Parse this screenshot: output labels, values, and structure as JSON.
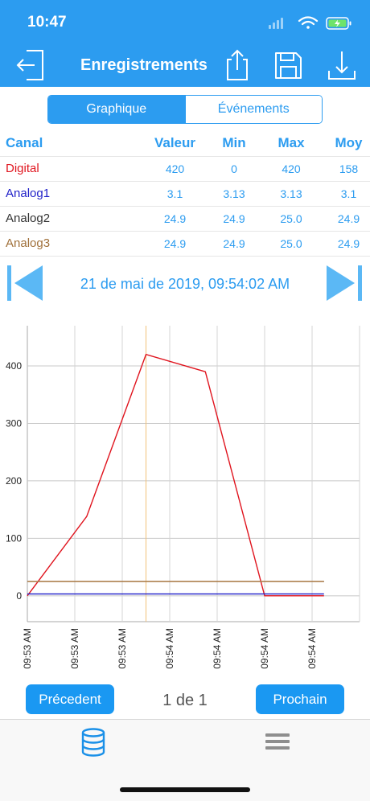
{
  "status": {
    "time": "10:47"
  },
  "header": {
    "title": "Enregistrements"
  },
  "segments": {
    "graph": "Graphique",
    "events": "Événements"
  },
  "table": {
    "headers": [
      "Canal",
      "Valeur",
      "Min",
      "Max",
      "Moy"
    ],
    "rows": [
      {
        "name": "Digital",
        "color": "#e0141e",
        "cells": [
          "420",
          "0",
          "420",
          "158"
        ]
      },
      {
        "name": "Analog1",
        "color": "#1f1fc8",
        "cells": [
          "3.1",
          "3.13",
          "3.13",
          "3.1"
        ]
      },
      {
        "name": "Analog2",
        "color": "#333333",
        "cells": [
          "24.9",
          "24.9",
          "25.0",
          "24.9"
        ]
      },
      {
        "name": "Analog3",
        "color": "#a0703a",
        "cells": [
          "24.9",
          "24.9",
          "25.0",
          "24.9"
        ]
      }
    ]
  },
  "date_nav": {
    "label": "21 de mai de 2019, 09:54:02 AM"
  },
  "chart_data": {
    "type": "line",
    "x": [
      "09:53 AM",
      "09:53 AM",
      "09:53 AM",
      "09:54 AM",
      "09:54 AM",
      "09:54 AM",
      "09:54 AM"
    ],
    "ylim": [
      -45,
      470
    ],
    "yticks": [
      0,
      100,
      200,
      300,
      400
    ],
    "grid": true,
    "cursor_x": 2.5,
    "series": [
      {
        "name": "Digital",
        "color": "#e0141e",
        "points": [
          [
            0,
            0
          ],
          [
            1.25,
            138
          ],
          [
            2.5,
            420
          ],
          [
            3.75,
            390
          ],
          [
            5,
            0
          ],
          [
            6.25,
            0
          ]
        ]
      },
      {
        "name": "Analog1",
        "color": "#1f1fc8",
        "points": [
          [
            0,
            3.1
          ],
          [
            6.25,
            3.1
          ]
        ]
      },
      {
        "name": "Analog2",
        "color": "#333333",
        "points": [
          [
            0,
            24.9
          ],
          [
            6.25,
            24.9
          ]
        ]
      },
      {
        "name": "Analog3",
        "color": "#c08a50",
        "points": [
          [
            0,
            24.9
          ],
          [
            6.25,
            24.9
          ]
        ]
      }
    ]
  },
  "pagination": {
    "prev": "Précedent",
    "indicator": "1 de 1",
    "next": "Prochain"
  },
  "icons": {
    "exit": "exit-icon",
    "share": "share-icon",
    "save": "save-icon",
    "download": "download-icon",
    "database": "database-icon",
    "menu": "menu-icon"
  },
  "colors": {
    "accent": "#2c9cf0",
    "cursor": "#f2c27a"
  }
}
